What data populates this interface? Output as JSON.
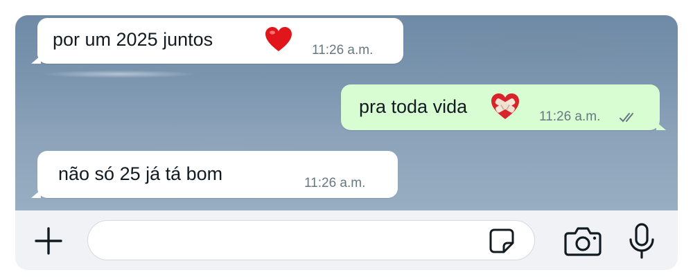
{
  "messages": [
    {
      "direction": "incoming",
      "text": "por um 2025 juntos",
      "emoji": "heart-emoji",
      "time": "11:26 a.m."
    },
    {
      "direction": "outgoing",
      "text": "pra toda vida",
      "emoji": "mending-heart-emoji",
      "time": "11:26 a.m.",
      "status": "read"
    },
    {
      "direction": "incoming",
      "text": "não só 25 já tá bom",
      "time": "11:26 a.m."
    }
  ],
  "composer": {
    "placeholder": ""
  },
  "icons": [
    "plus-icon",
    "sticker-icon",
    "camera-icon",
    "microphone-icon"
  ],
  "colors": {
    "incoming_bubble": "#ffffff",
    "outgoing_bubble": "#d9fdd3",
    "time_text": "#667781",
    "icon": "#111b21"
  }
}
